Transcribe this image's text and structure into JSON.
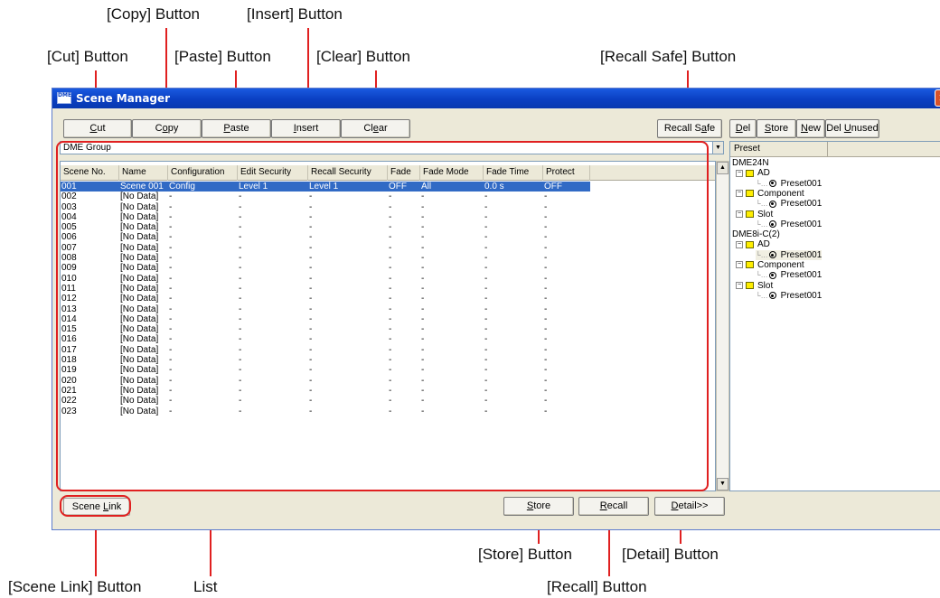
{
  "callouts": {
    "copy": "[Copy] Button",
    "insert": "[Insert] Button",
    "cut": "[Cut] Button",
    "paste": "[Paste] Button",
    "clear": "[Clear] Button",
    "recall_safe": "[Recall Safe] Button",
    "store": "[Store] Button",
    "detail": "[Detail] Button",
    "scene_link": "[Scene Link] Button",
    "list": "List",
    "recall": "[Recall] Button"
  },
  "window": {
    "title": "Scene Manager",
    "icon_text": "DME",
    "close_glyph": "×"
  },
  "toolbar": {
    "cut": {
      "pre": "",
      "ul": "C",
      "post": "ut"
    },
    "copy": {
      "pre": "C",
      "ul": "o",
      "post": "py"
    },
    "paste": {
      "pre": "",
      "ul": "P",
      "post": "aste"
    },
    "insert": {
      "pre": "",
      "ul": "I",
      "post": "nsert"
    },
    "clear": {
      "pre": "Cl",
      "ul": "e",
      "post": "ar"
    },
    "recall_safe": {
      "pre": "Recall S",
      "ul": "a",
      "post": "fe"
    },
    "del": {
      "pre": "",
      "ul": "D",
      "post": "el"
    },
    "store_top": {
      "pre": "",
      "ul": "S",
      "post": "tore"
    },
    "new": {
      "pre": "",
      "ul": "N",
      "post": "ew"
    },
    "del_unused": {
      "pre": "Del ",
      "ul": "U",
      "post": "nused"
    }
  },
  "group_select": "DME Group",
  "list": {
    "columns": [
      "Scene No.",
      "Name",
      "Configuration",
      "Edit Security",
      "Recall Security",
      "Fade",
      "Fade Mode",
      "Fade Time",
      "Protect"
    ],
    "rows": [
      [
        "001",
        "Scene 001",
        "Config",
        "Level 1",
        "Level 1",
        "OFF",
        "All",
        "0.0 s",
        "OFF"
      ],
      [
        "002",
        "[No Data]",
        "-",
        "-",
        "-",
        "-",
        "-",
        "-",
        "-"
      ],
      [
        "003",
        "[No Data]",
        "-",
        "-",
        "-",
        "-",
        "-",
        "-",
        "-"
      ],
      [
        "004",
        "[No Data]",
        "-",
        "-",
        "-",
        "-",
        "-",
        "-",
        "-"
      ],
      [
        "005",
        "[No Data]",
        "-",
        "-",
        "-",
        "-",
        "-",
        "-",
        "-"
      ],
      [
        "006",
        "[No Data]",
        "-",
        "-",
        "-",
        "-",
        "-",
        "-",
        "-"
      ],
      [
        "007",
        "[No Data]",
        "-",
        "-",
        "-",
        "-",
        "-",
        "-",
        "-"
      ],
      [
        "008",
        "[No Data]",
        "-",
        "-",
        "-",
        "-",
        "-",
        "-",
        "-"
      ],
      [
        "009",
        "[No Data]",
        "-",
        "-",
        "-",
        "-",
        "-",
        "-",
        "-"
      ],
      [
        "010",
        "[No Data]",
        "-",
        "-",
        "-",
        "-",
        "-",
        "-",
        "-"
      ],
      [
        "011",
        "[No Data]",
        "-",
        "-",
        "-",
        "-",
        "-",
        "-",
        "-"
      ],
      [
        "012",
        "[No Data]",
        "-",
        "-",
        "-",
        "-",
        "-",
        "-",
        "-"
      ],
      [
        "013",
        "[No Data]",
        "-",
        "-",
        "-",
        "-",
        "-",
        "-",
        "-"
      ],
      [
        "014",
        "[No Data]",
        "-",
        "-",
        "-",
        "-",
        "-",
        "-",
        "-"
      ],
      [
        "015",
        "[No Data]",
        "-",
        "-",
        "-",
        "-",
        "-",
        "-",
        "-"
      ],
      [
        "016",
        "[No Data]",
        "-",
        "-",
        "-",
        "-",
        "-",
        "-",
        "-"
      ],
      [
        "017",
        "[No Data]",
        "-",
        "-",
        "-",
        "-",
        "-",
        "-",
        "-"
      ],
      [
        "018",
        "[No Data]",
        "-",
        "-",
        "-",
        "-",
        "-",
        "-",
        "-"
      ],
      [
        "019",
        "[No Data]",
        "-",
        "-",
        "-",
        "-",
        "-",
        "-",
        "-"
      ],
      [
        "020",
        "[No Data]",
        "-",
        "-",
        "-",
        "-",
        "-",
        "-",
        "-"
      ],
      [
        "021",
        "[No Data]",
        "-",
        "-",
        "-",
        "-",
        "-",
        "-",
        "-"
      ],
      [
        "022",
        "[No Data]",
        "-",
        "-",
        "-",
        "-",
        "-",
        "-",
        "-"
      ],
      [
        "023",
        "[No Data]",
        "-",
        "-",
        "-",
        "-",
        "-",
        "-",
        "-"
      ]
    ]
  },
  "preset_panel": {
    "header": "Preset",
    "devices": [
      {
        "name": "DME24N",
        "folders": [
          {
            "name": "AD",
            "preset": "Preset001"
          },
          {
            "name": "Component",
            "preset": "Preset001"
          },
          {
            "name": "Slot",
            "preset": "Preset001"
          }
        ]
      },
      {
        "name": "DME8i-C(2)",
        "folders": [
          {
            "name": "AD",
            "preset": "Preset001"
          },
          {
            "name": "Component",
            "preset": "Preset001"
          },
          {
            "name": "Slot",
            "preset": "Preset001"
          }
        ]
      }
    ]
  },
  "bottom": {
    "scene_link": {
      "pre": "Scene ",
      "ul": "L",
      "post": "ink"
    },
    "store": {
      "pre": "",
      "ul": "S",
      "post": "tore"
    },
    "recall": {
      "pre": "",
      "ul": "R",
      "post": "ecall"
    },
    "detail": {
      "pre": "",
      "ul": "D",
      "post": "etail>>"
    }
  },
  "colors": {
    "annotation": "#e02020",
    "selection": "#316ac5",
    "titlebar": "#0a3fc2"
  }
}
